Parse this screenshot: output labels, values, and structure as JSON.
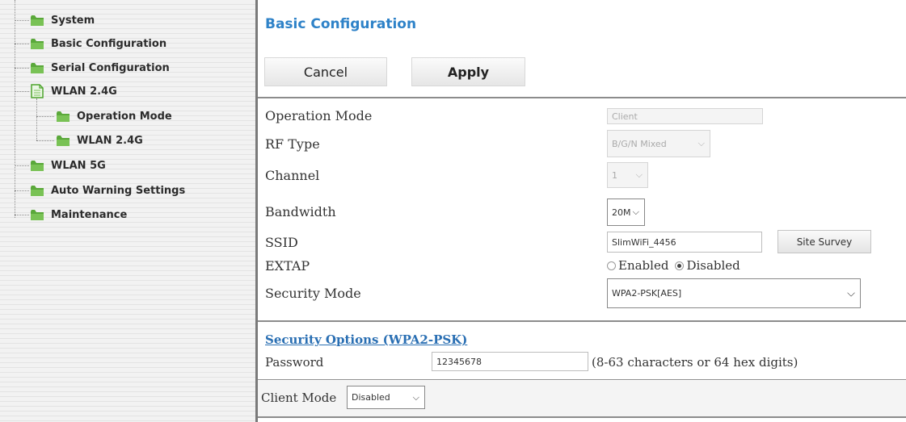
{
  "sidebar": {
    "items": [
      {
        "label": "System",
        "icon": "folder-icon"
      },
      {
        "label": "Basic Configuration",
        "icon": "folder-icon"
      },
      {
        "label": "Serial Configuration",
        "icon": "folder-icon"
      },
      {
        "label": "WLAN 2.4G",
        "icon": "document-icon"
      },
      {
        "label": "Operation Mode",
        "icon": "folder-icon"
      },
      {
        "label": "WLAN 2.4G",
        "icon": "folder-icon"
      },
      {
        "label": "WLAN 5G",
        "icon": "folder-icon"
      },
      {
        "label": "Auto Warning Settings",
        "icon": "folder-icon"
      },
      {
        "label": "Maintenance",
        "icon": "folder-icon"
      }
    ]
  },
  "main": {
    "title": "Basic Configuration",
    "cancel_label": "Cancel",
    "apply_label": "Apply",
    "fields": {
      "operation_mode": {
        "label": "Operation Mode",
        "value": "Client"
      },
      "rf_type": {
        "label": "RF Type",
        "value": "B/G/N Mixed"
      },
      "channel": {
        "label": "Channel",
        "value": "1"
      },
      "bandwidth": {
        "label": "Bandwidth",
        "value": "20M"
      },
      "ssid": {
        "label": "SSID",
        "value": "SlimWiFi_4456",
        "site_survey_label": "Site Survey"
      },
      "extap": {
        "label": "EXTAP",
        "option_enabled": "Enabled",
        "option_disabled": "Disabled",
        "selected": "Disabled"
      },
      "security_mode": {
        "label": "Security Mode",
        "value": "WPA2-PSK[AES]"
      }
    },
    "security_options": {
      "heading": "Security Options (WPA2-PSK)",
      "password_label": "Password",
      "password_value": "12345678",
      "password_hint": "(8-63 characters or 64 hex digits)"
    },
    "client_mode": {
      "label": "Client Mode",
      "value": "Disabled"
    }
  },
  "colors": {
    "title": "#2e82c8",
    "folder": "#5aa83a",
    "link": "#2a6fb3"
  }
}
